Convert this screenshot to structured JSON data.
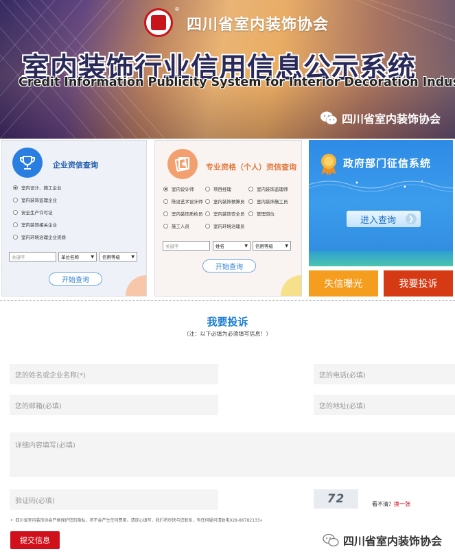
{
  "banner": {
    "org_name": "四川省室内装饰协会",
    "title_cn": "室内装饰行业信用信息公示系统",
    "title_en": "Credit Information Publicity System for Interior Decoration Industry",
    "wechat_name": "四川省室内装饰协会",
    "logo_mark": "®"
  },
  "enterprise": {
    "title": "企业资信查询",
    "options": [
      "室内设计、施工企业",
      "室内装饰监理企业",
      "安全生产许可证",
      "室内装饰相关企业",
      "室内环境治理企业资质"
    ],
    "keyword_placeholder": "关键字",
    "select1": "单位名称",
    "select2": "信用等级",
    "search_label": "开始查询"
  },
  "personal": {
    "title": "专业资格（个人）资信查询",
    "options": [
      "室内设计师",
      "项目经理",
      "室内装饰监理师",
      "陈设艺术设计师",
      "室内装饰预算员",
      "室内装饰施工员",
      "室内装饰质检员",
      "室内装饰安全员",
      "管理岗位",
      "施工人员",
      "室内环境治理员"
    ],
    "keyword_placeholder": "关键字",
    "select1": "姓名",
    "select2": "信用等级",
    "search_label": "开始查询"
  },
  "gov": {
    "title": "政府部门征信系统",
    "enter_label": "进入查询"
  },
  "actions": {
    "dishonest_label": "失信曝光",
    "complaint_label": "我要投诉"
  },
  "form": {
    "title": "我要投诉",
    "note": "（注：以下必填为必须填写信息！）",
    "name_placeholder": "您的姓名或企业名称(*)",
    "phone_placeholder": "您的电话(必填)",
    "email_placeholder": "您的邮箱(必填)",
    "address_placeholder": "您的地址(必填)",
    "detail_placeholder": "详细内容填写(必填)",
    "captcha_placeholder": "验证码(必填)",
    "captcha_text": "72",
    "captcha_hint": "看不清？",
    "captcha_refresh": "换一张",
    "privacy": "四川省室内装饰协会严格保护您的隐私，将不会产生任何费用，请放心填写，我们将尽快与您联系，有任何疑问请致电028-86782133»",
    "submit_label": "提交信息"
  },
  "footer": {
    "wechat_name": "四川省室内装饰协会"
  },
  "colors": {
    "enterprise_accent": "#2a7ee0",
    "personal_accent": "#f3a070",
    "gov_blue": "#2e8be6",
    "orange": "#f49d1e",
    "red": "#d63a14",
    "submit_red": "#d0101b"
  }
}
